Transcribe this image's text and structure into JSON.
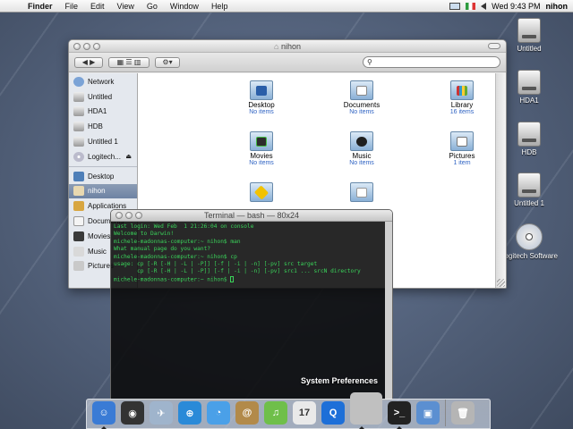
{
  "menubar": {
    "apple_glyph": "",
    "items": [
      "Finder",
      "File",
      "Edit",
      "View",
      "Go",
      "Window",
      "Help"
    ],
    "clock": "Wed 9:43 PM",
    "user": "nihon"
  },
  "desktop_icons": [
    {
      "label": "Untitled",
      "icon": "hard-drive-icon"
    },
    {
      "label": "HDA1",
      "icon": "hard-drive-icon"
    },
    {
      "label": "HDB",
      "icon": "hard-drive-icon"
    },
    {
      "label": "Untitled 1",
      "icon": "hard-drive-icon"
    },
    {
      "label": "Logitech Software",
      "icon": "cd-icon"
    }
  ],
  "finder": {
    "title": "nihon",
    "sidebar": [
      {
        "label": "Network",
        "icon": "network-icon"
      },
      {
        "label": "Untitled",
        "icon": "disk-icon"
      },
      {
        "label": "HDA1",
        "icon": "disk-icon"
      },
      {
        "label": "HDB",
        "icon": "disk-icon"
      },
      {
        "label": "Untitled 1",
        "icon": "disk-icon"
      },
      {
        "label": "Logitech...",
        "icon": "cd-icon",
        "eject": "⏏"
      },
      {
        "label": "Desktop",
        "icon": "desktop-icon"
      },
      {
        "label": "nihon",
        "icon": "home-icon",
        "selected": true
      },
      {
        "label": "Applications",
        "icon": "applications-icon"
      },
      {
        "label": "Documents",
        "icon": "documents-icon"
      },
      {
        "label": "Movies",
        "icon": "movies-icon"
      },
      {
        "label": "Music",
        "icon": "music-icon"
      },
      {
        "label": "Pictures",
        "icon": "pictures-icon"
      }
    ],
    "items": [
      {
        "name": "Desktop",
        "sub": "No items",
        "icon": "desktop-folder-icon"
      },
      {
        "name": "Documents",
        "sub": "No items",
        "icon": "documents-folder-icon"
      },
      {
        "name": "Library",
        "sub": "16 items",
        "icon": "library-folder-icon"
      },
      {
        "name": "Movies",
        "sub": "No items",
        "icon": "movies-folder-icon"
      },
      {
        "name": "Music",
        "sub": "No items",
        "icon": "music-folder-icon"
      },
      {
        "name": "Pictures",
        "sub": "1 item",
        "icon": "pictures-folder-icon"
      },
      {
        "name": "",
        "sub": "",
        "icon": "public-folder-icon"
      },
      {
        "name": "",
        "sub": "",
        "icon": "sites-folder-icon"
      }
    ]
  },
  "terminal": {
    "title": "Terminal — bash — 80x24",
    "lines": [
      "Last login: Wed Feb  1 21:26:04 on console",
      "Welcome to Darwin!",
      "michele-madonnas-computer:~ nihon$ man",
      "What manual page do you want?",
      "michele-madonnas-computer:~ nihon$ cp",
      "usage: cp [-R [-H | -L | -P]] [-f | -i | -n] [-pv] src target",
      "       cp [-R [-H | -L | -P]] [-f | -i | -n] [-pv] src1 ... srcN directory",
      "michele-madonnas-computer:~ nihon$ "
    ]
  },
  "dock": {
    "hover_label": "System Preferences",
    "items": [
      {
        "name": "finder",
        "icon": "finder-icon",
        "color": "#3a7bd5",
        "glyph": "☺",
        "running": true
      },
      {
        "name": "dashboard",
        "icon": "dashboard-icon",
        "color": "#333333",
        "glyph": "◉"
      },
      {
        "name": "mail",
        "icon": "mail-icon",
        "color": "#9fb4cc",
        "glyph": "✈"
      },
      {
        "name": "safari",
        "icon": "safari-icon",
        "color": "#2a8ad8",
        "glyph": "⊕"
      },
      {
        "name": "ichat",
        "icon": "ichat-icon",
        "color": "#4aa0e8",
        "glyph": "◔"
      },
      {
        "name": "address-book",
        "icon": "address-book-icon",
        "color": "#b28a4a",
        "glyph": "@"
      },
      {
        "name": "itunes",
        "icon": "itunes-icon",
        "color": "#6fbf4a",
        "glyph": "♫"
      },
      {
        "name": "ical",
        "icon": "ical-icon",
        "color": "#e9e9e9",
        "glyph": "17"
      },
      {
        "name": "quicktime",
        "icon": "quicktime-icon",
        "color": "#1d6fd8",
        "glyph": "Q"
      },
      {
        "name": "system-preferences",
        "icon": "system-preferences-icon",
        "color": "#c0c0c0",
        "glyph": "",
        "running": true,
        "hovered": true
      },
      {
        "name": "terminal",
        "icon": "terminal-icon",
        "color": "#222222",
        "glyph": ">_",
        "running": true
      },
      {
        "name": "preview",
        "icon": "preview-icon",
        "color": "#5b8fd1",
        "glyph": "▣"
      },
      {
        "name": "trash",
        "icon": "trash-icon",
        "color": "#b5b5b5",
        "glyph": "🗑"
      }
    ]
  },
  "colors": {
    "selection": "#6e83a3",
    "terminal_text": "#3ad35a",
    "folder_sub": "#2f63c3"
  }
}
